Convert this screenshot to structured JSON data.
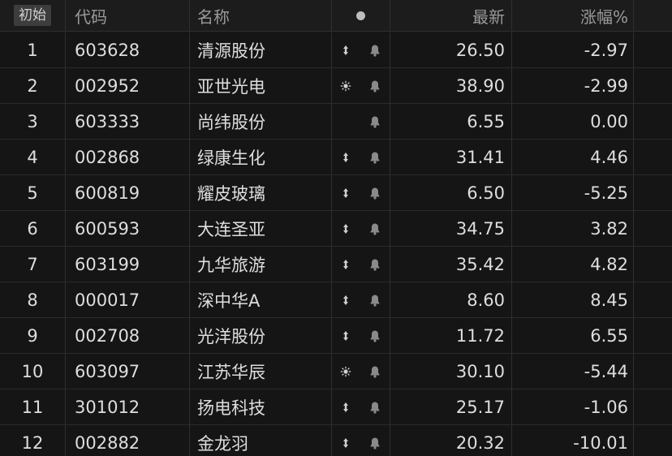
{
  "header": {
    "index_label": "初始",
    "code_label": "代码",
    "name_label": "名称",
    "mark_icon": "dot-icon",
    "price_label": "最新",
    "change_label": "涨幅%"
  },
  "colors": {
    "up": "#f23b3b",
    "down": "#2ec245",
    "flat": "#e6e6e6",
    "background": "#151515"
  },
  "rows": [
    {
      "idx": "1",
      "code": "603628",
      "name": "清源股份",
      "mark": "updown-arrow-icon",
      "bell": "bell-icon",
      "price": "26.50",
      "change": "-2.97",
      "trend": "down"
    },
    {
      "idx": "2",
      "code": "002952",
      "name": "亚世光电",
      "mark": "sun-icon",
      "bell": "bell-icon",
      "price": "38.90",
      "change": "-2.99",
      "trend": "down"
    },
    {
      "idx": "3",
      "code": "603333",
      "name": "尚纬股份",
      "mark": "",
      "bell": "bell-icon",
      "price": "6.55",
      "change": "0.00",
      "trend": "flat"
    },
    {
      "idx": "4",
      "code": "002868",
      "name": "绿康生化",
      "mark": "updown-arrow-icon",
      "bell": "bell-icon",
      "price": "31.41",
      "change": "4.46",
      "trend": "up"
    },
    {
      "idx": "5",
      "code": "600819",
      "name": "耀皮玻璃",
      "mark": "updown-arrow-icon",
      "bell": "bell-icon",
      "price": "6.50",
      "change": "-5.25",
      "trend": "down"
    },
    {
      "idx": "6",
      "code": "600593",
      "name": "大连圣亚",
      "mark": "updown-arrow-icon",
      "bell": "bell-icon",
      "price": "34.75",
      "change": "3.82",
      "trend": "up"
    },
    {
      "idx": "7",
      "code": "603199",
      "name": "九华旅游",
      "mark": "updown-arrow-icon",
      "bell": "bell-icon",
      "price": "35.42",
      "change": "4.82",
      "trend": "up"
    },
    {
      "idx": "8",
      "code": "000017",
      "name": "深中华A",
      "mark": "updown-arrow-icon",
      "bell": "bell-icon",
      "price": "8.60",
      "change": "8.45",
      "trend": "up"
    },
    {
      "idx": "9",
      "code": "002708",
      "name": "光洋股份",
      "mark": "updown-arrow-icon",
      "bell": "bell-icon",
      "price": "11.72",
      "change": "6.55",
      "trend": "up"
    },
    {
      "idx": "10",
      "code": "603097",
      "name": "江苏华辰",
      "mark": "sun-icon",
      "bell": "bell-icon",
      "price": "30.10",
      "change": "-5.44",
      "trend": "down"
    },
    {
      "idx": "11",
      "code": "301012",
      "name": "扬电科技",
      "mark": "updown-arrow-icon",
      "bell": "bell-icon",
      "price": "25.17",
      "change": "-1.06",
      "trend": "down"
    },
    {
      "idx": "12",
      "code": "002882",
      "name": "金龙羽",
      "mark": "updown-arrow-icon",
      "bell": "bell-icon",
      "price": "20.32",
      "change": "-10.01",
      "trend": "down"
    }
  ]
}
